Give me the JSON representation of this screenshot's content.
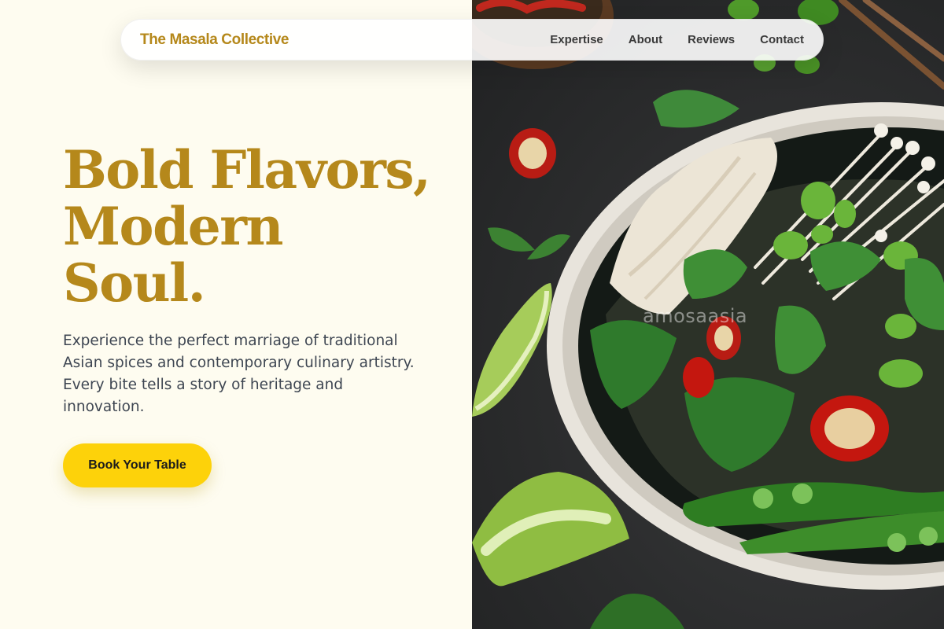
{
  "nav": {
    "brand": "The Masala Collective",
    "links": [
      {
        "label": "Expertise"
      },
      {
        "label": "About"
      },
      {
        "label": "Reviews"
      },
      {
        "label": "Contact"
      }
    ]
  },
  "hero": {
    "headline": [
      "Bold Flavors,",
      "Modern",
      "Soul."
    ],
    "subtext": "Experience the perfect marriage of traditional Asian spices and contemporary culinary artistry. Every bite tells a story of heritage and innovation.",
    "cta_label": "Book Your Table",
    "image_watermark": "amosaasia"
  },
  "colors": {
    "background": "#fefcf0",
    "brand_gold": "#b5881b",
    "cta_yellow": "#fdd20a",
    "body_text": "#3e4652"
  }
}
